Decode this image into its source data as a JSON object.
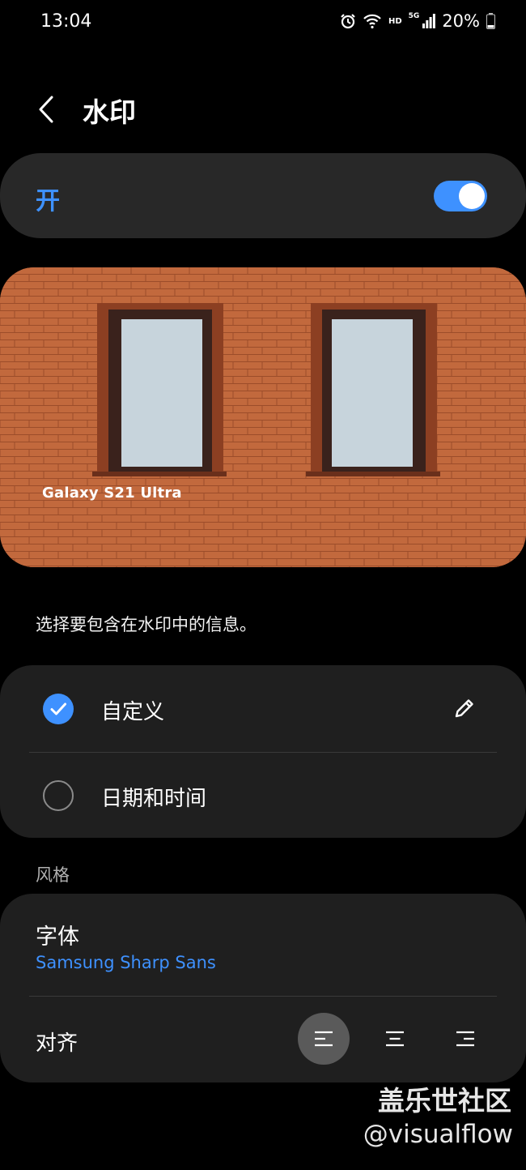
{
  "status_bar": {
    "time": "13:04",
    "hd": "HD",
    "network": "5G",
    "battery": "20%"
  },
  "header": {
    "title": "水印"
  },
  "master_switch": {
    "label": "开",
    "on": true,
    "accent": "#3e91ff"
  },
  "preview": {
    "watermark_text": "Galaxy S21 Ultra"
  },
  "hint": "选择要包含在水印中的信息。",
  "options": [
    {
      "label": "自定义",
      "selected": true
    },
    {
      "label": "日期和时间",
      "selected": false
    }
  ],
  "style": {
    "section_label": "风格",
    "font": {
      "label": "字体",
      "value": "Samsung Sharp Sans"
    },
    "align": {
      "label": "对齐",
      "selected": "left"
    }
  },
  "overlay": {
    "line1": "盖乐世社区",
    "line2": "@visualflow"
  }
}
